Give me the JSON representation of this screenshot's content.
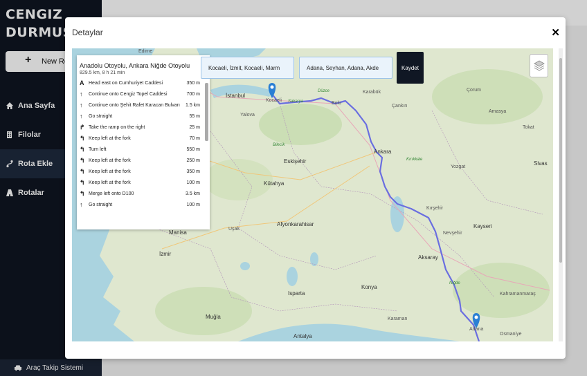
{
  "sidebar": {
    "brand_line1": "CENGIZ",
    "brand_line2": "DURMUŞ",
    "new_report_label": "New Repo",
    "items": [
      {
        "label": "Ana Sayfa",
        "icon": "home-icon"
      },
      {
        "label": "Filolar",
        "icon": "building-icon"
      },
      {
        "label": "Rota Ekle",
        "icon": "route-icon"
      },
      {
        "label": "Rotalar",
        "icon": "road-icon"
      }
    ],
    "footer_label": "Araç Takip Sistemi",
    "footer_icon": "car-icon"
  },
  "modal": {
    "title": "Detaylar",
    "close_icon": "close-icon"
  },
  "route": {
    "title": "Anadolu Otoyolu, Ankara Niğde Otoyolu",
    "summary": "829.5 km, 8 h 21 min",
    "steps": [
      {
        "icon": "start-icon",
        "text": "Head east on Cumhuriyet Caddesi",
        "distance": "350 m"
      },
      {
        "icon": "straight-icon",
        "text": "Continue onto Cengiz Topel Caddesi",
        "distance": "700 m"
      },
      {
        "icon": "straight-icon",
        "text": "Continue onto Şehit Rafet Karacan Bulvarı",
        "distance": "1.5 km"
      },
      {
        "icon": "straight-icon",
        "text": "Go straight",
        "distance": "55 m"
      },
      {
        "icon": "ramp-right-icon",
        "text": "Take the ramp on the right",
        "distance": "25 m"
      },
      {
        "icon": "keep-left-icon",
        "text": "Keep left at the fork",
        "distance": "70 m"
      },
      {
        "icon": "turn-left-icon",
        "text": "Turn left",
        "distance": "550 m"
      },
      {
        "icon": "keep-left-icon",
        "text": "Keep left at the fork",
        "distance": "250 m"
      },
      {
        "icon": "keep-left-icon",
        "text": "Keep left at the fork",
        "distance": "350 m"
      },
      {
        "icon": "keep-left-icon",
        "text": "Keep left at the fork",
        "distance": "100 m"
      },
      {
        "icon": "merge-left-icon",
        "text": "Merge left onto D100",
        "distance": "3.5 km"
      },
      {
        "icon": "straight-icon",
        "text": "Go straight",
        "distance": "100 m"
      }
    ]
  },
  "inputs": {
    "origin": "Kocaeli, İzmit, Kocaeli, Marm",
    "destination": "Adana, Seyhan, Adana, Akde"
  },
  "save_label": "Kaydet",
  "map": {
    "labels": [
      "Edirne",
      "İstanbul",
      "Kocaeli",
      "Sakarya",
      "Düzce",
      "Bolu",
      "Yalova",
      "Bilecik",
      "Eskişehir",
      "Ankara",
      "Kırıkkale",
      "Yozgat",
      "Sivas",
      "Kütahya",
      "Kırşehir",
      "Nevşehir",
      "Kayseri",
      "Afyonkarahisar",
      "Manisa",
      "Uşak",
      "İzmir",
      "Aksaray",
      "Niğde",
      "Konya",
      "Isparta",
      "Muğla",
      "Karaman",
      "Kahramanmaraş",
      "Antalya",
      "Osmaniye",
      "Adana",
      "Çorum",
      "Amasya",
      "Tokat",
      "Çankırı",
      "Karabük"
    ],
    "route_color": "#6a6ee0",
    "water_color": "#aad3df",
    "land_color": "#dfe7cf",
    "marker_color": "#2a7fd4"
  }
}
